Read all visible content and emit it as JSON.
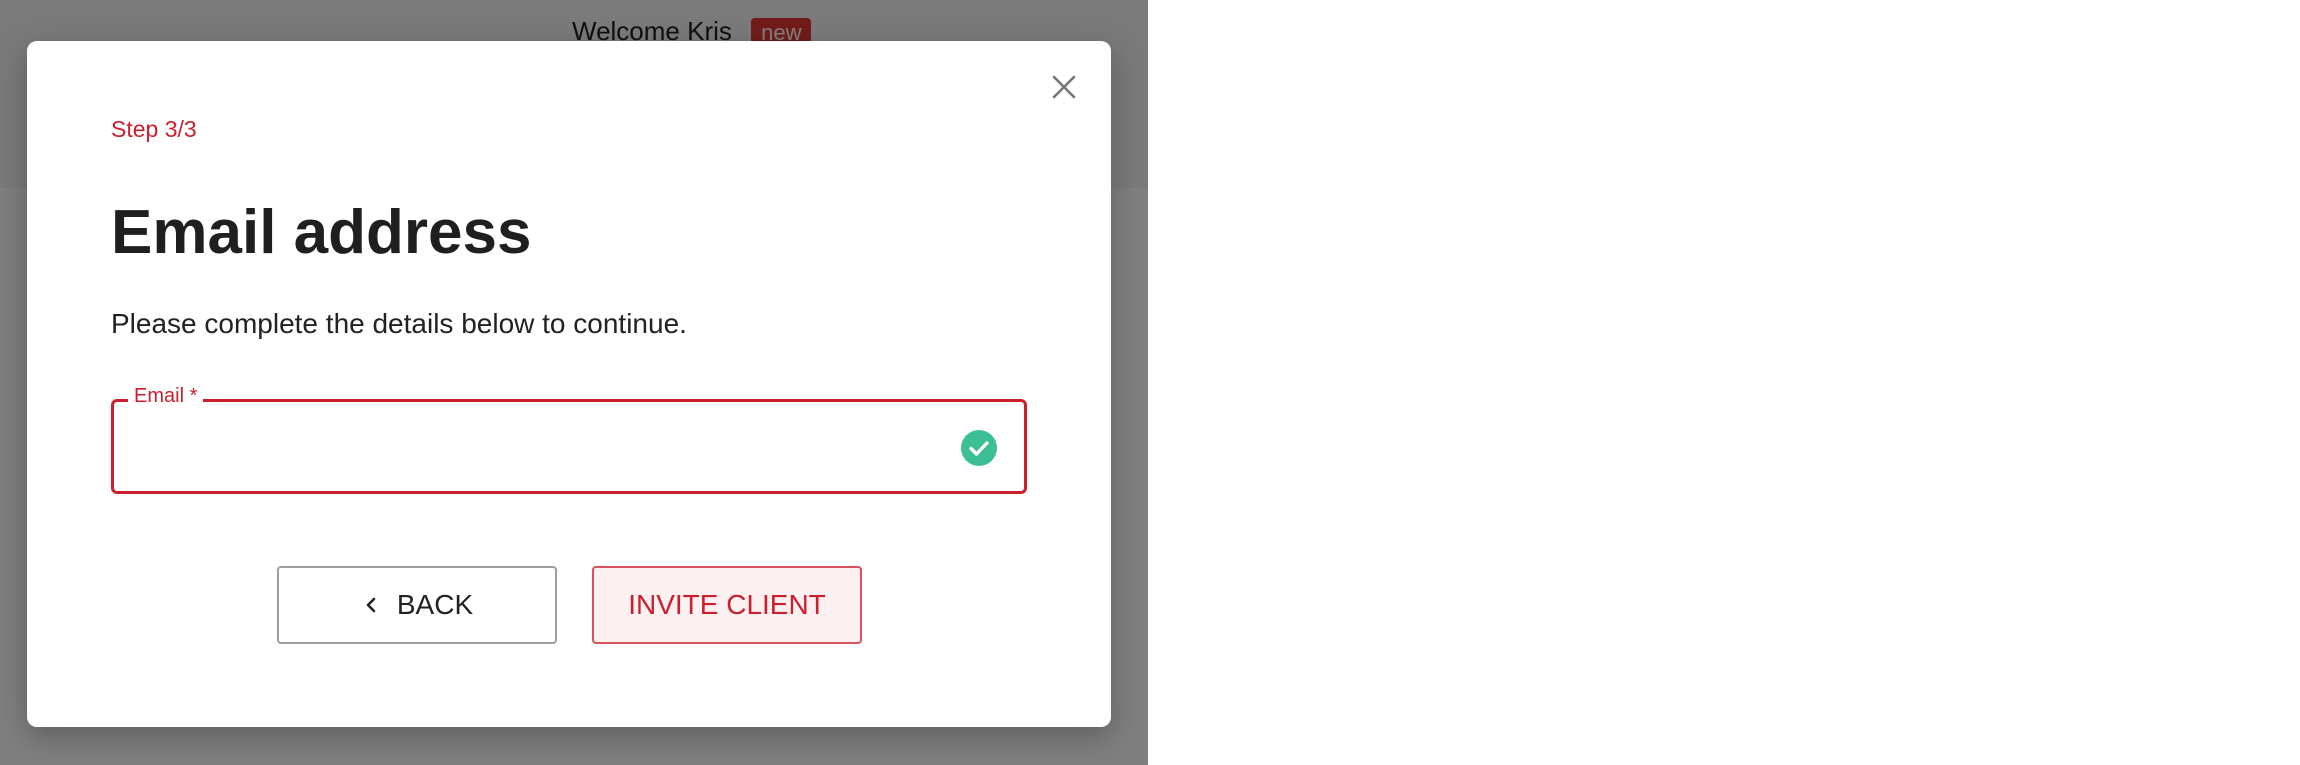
{
  "background_app": {
    "header_text": "Welcome Kris",
    "badge_text": "new"
  },
  "modal": {
    "step": "Step 3/3",
    "title": "Email address",
    "subtitle": "Please complete the details below to continue.",
    "email_field": {
      "label": "Email *",
      "value": "",
      "status_icon": "check-circle-icon"
    },
    "buttons": {
      "back_label": "BACK",
      "back_icon": "chevron-left-icon",
      "invite_label": "INVITE CLIENT"
    },
    "close_icon": "close-icon"
  },
  "colors": {
    "accent": "#cc1f2d",
    "success": "#3dbf96",
    "backdrop": "rgba(0,0,0,0.5)"
  }
}
